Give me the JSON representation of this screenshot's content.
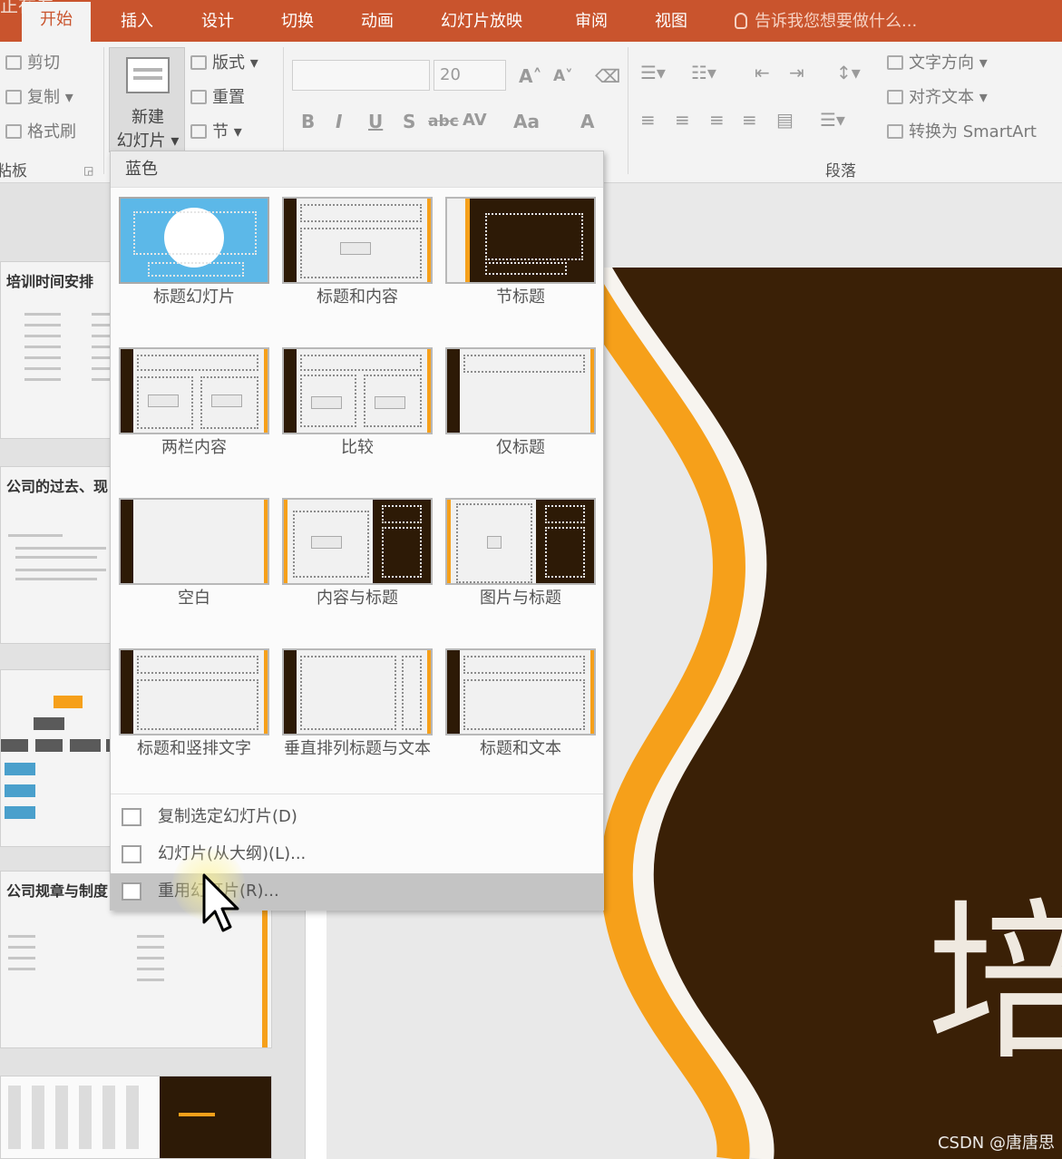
{
  "window": {
    "partial_top_text": "正在看"
  },
  "tabs": [
    {
      "label": "开始",
      "active": true
    },
    {
      "label": "插入"
    },
    {
      "label": "设计"
    },
    {
      "label": "切换"
    },
    {
      "label": "动画"
    },
    {
      "label": "幻灯片放映"
    },
    {
      "label": "审阅"
    },
    {
      "label": "视图"
    }
  ],
  "tell_me": "告诉我您想要做什么...",
  "ribbon": {
    "clipboard": {
      "cut": "剪切",
      "copy": "复制",
      "format_painter": "格式刷",
      "group_label": "粘板"
    },
    "slides": {
      "new_slide_line1": "新建",
      "new_slide_line2": "幻灯片",
      "layout": "版式",
      "reset": "重置",
      "section": "节"
    },
    "font": {
      "font_name": "",
      "font_size": "20",
      "bold": "B",
      "italic": "I",
      "underline": "U",
      "shadow": "S",
      "strike": "abc",
      "spacing": "AV",
      "case": "Aa",
      "color": "A"
    },
    "paragraph": {
      "text_direction": "文字方向",
      "align_text": "对齐文本",
      "convert_smartart": "转换为 SmartArt",
      "group_label": "段落"
    }
  },
  "gallery": {
    "theme_name": "蓝色",
    "layouts": [
      {
        "label": "标题幻灯片"
      },
      {
        "label": "标题和内容"
      },
      {
        "label": "节标题"
      },
      {
        "label": "两栏内容"
      },
      {
        "label": "比较"
      },
      {
        "label": "仅标题"
      },
      {
        "label": "空白"
      },
      {
        "label": "内容与标题"
      },
      {
        "label": "图片与标题"
      },
      {
        "label": "标题和竖排文字"
      },
      {
        "label": "垂直排列标题与文本"
      },
      {
        "label": "标题和文本"
      }
    ],
    "menu": [
      {
        "label": "复制选定幻灯片(D)"
      },
      {
        "label": "幻灯片(从大纲)(L)..."
      },
      {
        "label": "重用幻灯片(R)...",
        "hover": true
      }
    ]
  },
  "thumbnails": [
    {
      "title": "培训时间安排"
    },
    {
      "title": "公司的过去、现"
    },
    {
      "title": ""
    },
    {
      "title": "公司规章与制度"
    },
    {
      "title": ""
    }
  ],
  "slide": {
    "visible_title_char": "培"
  },
  "watermark": "CSDN @唐唐思",
  "colors": {
    "tab_bar": "#c9542d",
    "slide_dark": "#3a2006",
    "accent_gold": "#f6a01a"
  }
}
